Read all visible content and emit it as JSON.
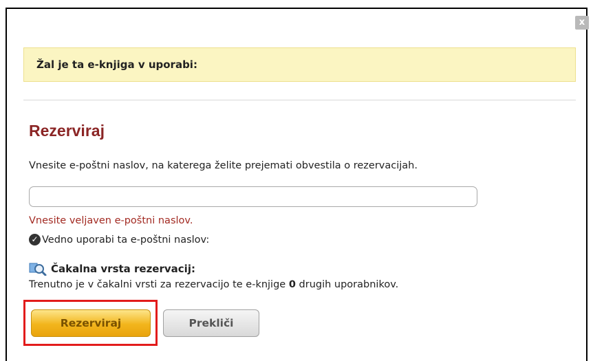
{
  "dialog": {
    "close_label": "x",
    "notice": "Žal je ta e-knjiga v uporabi:",
    "section_title": "Rezerviraj",
    "instructions": "Vnesite e-poštni naslov, na katerega želite prejemati obvestila o rezervacijah.",
    "email_input": {
      "value": "",
      "placeholder": ""
    },
    "error": "Vnesite veljaven e-poštni naslov.",
    "remember_email": {
      "label": "Vedno uporabi ta e-poštni naslov:",
      "checked": true
    },
    "queue": {
      "heading": "Čakalna vrsta rezervacij:",
      "text_before": "Trenutno je v čakalni vrsti za rezervacijo te e-knjige ",
      "count": "0",
      "text_after": " drugih uporabnikov."
    },
    "buttons": {
      "reserve": "Rezerviraj",
      "cancel": "Prekliči"
    }
  }
}
